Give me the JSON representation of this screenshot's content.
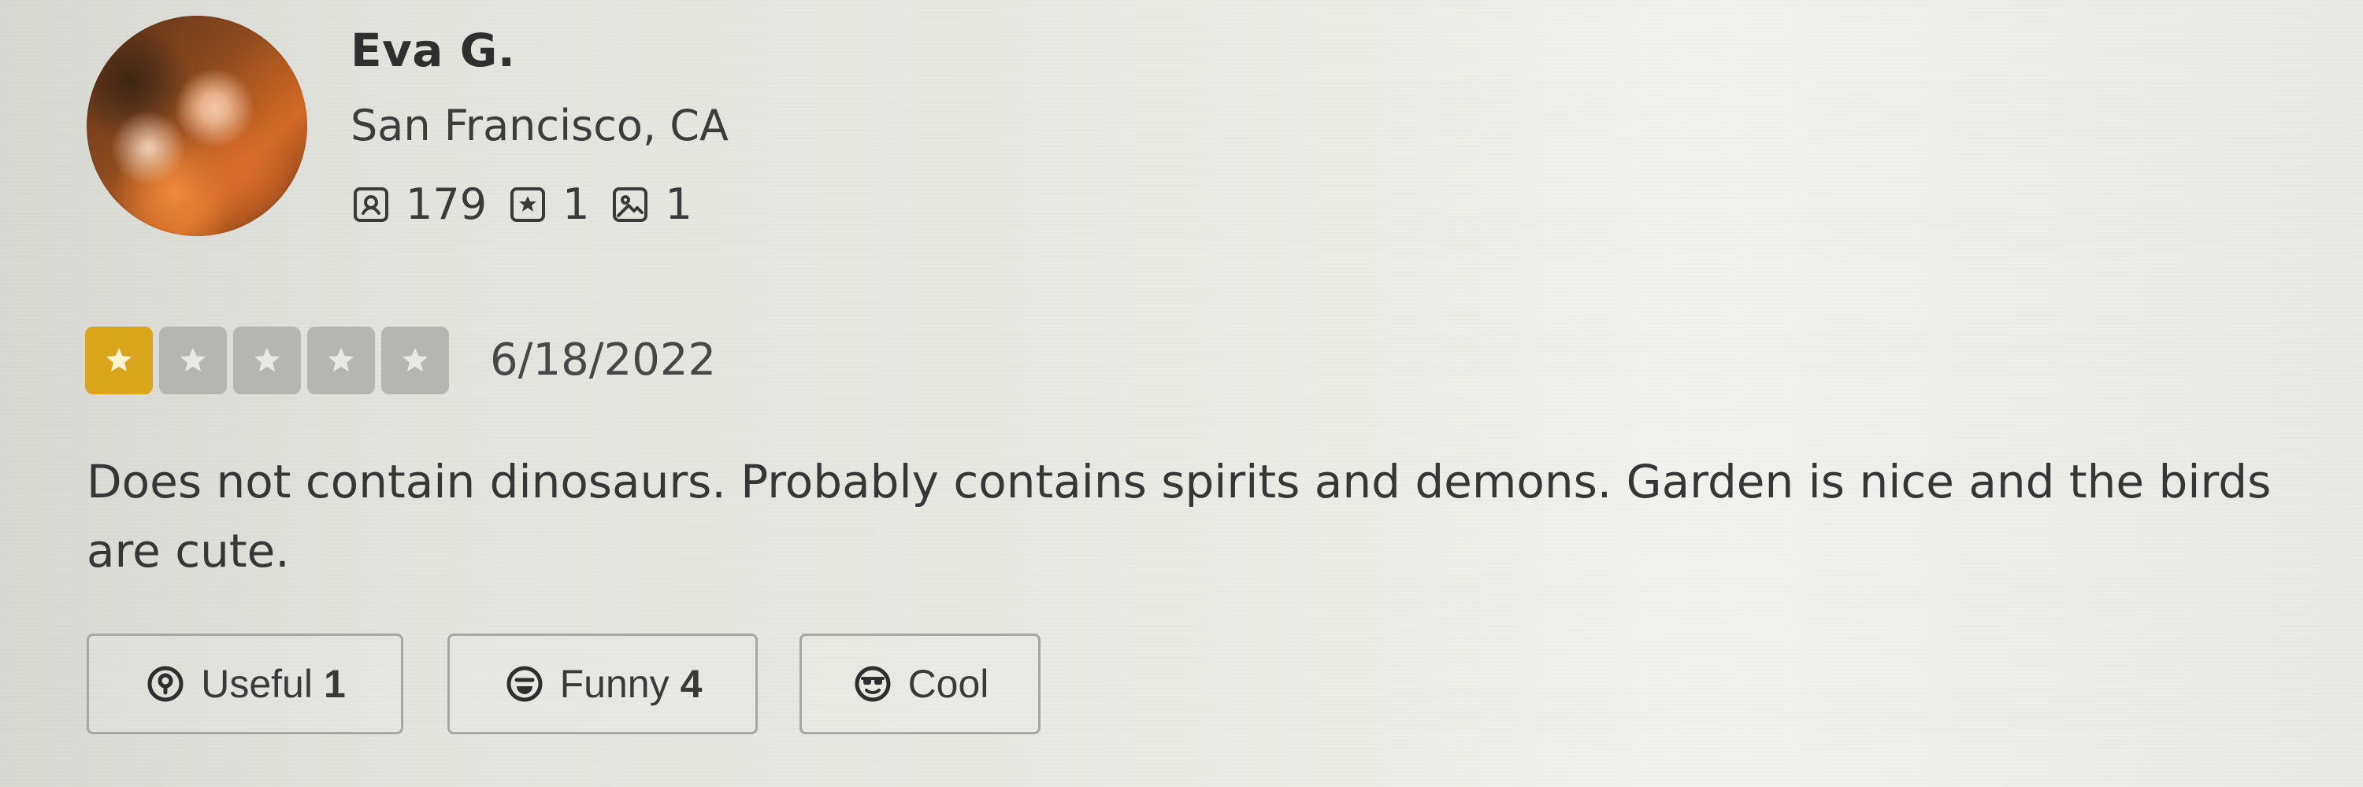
{
  "reviewer": {
    "name": "Eva G.",
    "location": "San Francisco, CA",
    "stats": [
      {
        "icon": "friends-icon",
        "value": "179"
      },
      {
        "icon": "star-badge-icon",
        "value": "1"
      },
      {
        "icon": "photo-icon",
        "value": "1"
      }
    ]
  },
  "rating": {
    "stars_filled": 1,
    "stars_total": 5,
    "date": "6/18/2022",
    "accent": "#d9a51a"
  },
  "review": {
    "text": "Does not contain dinosaurs. Probably contains spirits and demons. Garden is nice and the birds are cute."
  },
  "actions": {
    "useful": {
      "label": "Useful",
      "count": "1"
    },
    "funny": {
      "label": "Funny",
      "count": "4"
    },
    "cool": {
      "label": "Cool"
    }
  }
}
